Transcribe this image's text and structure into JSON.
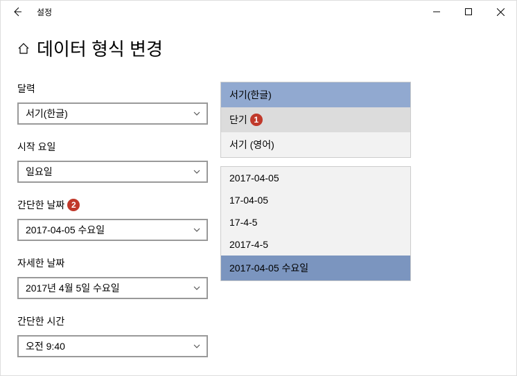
{
  "titlebar": {
    "app_title": "설정"
  },
  "page": {
    "title": "데이터 형식 변경"
  },
  "fields": {
    "calendar": {
      "label": "달력",
      "value": "서기(한글)"
    },
    "first_day": {
      "label": "시작 요일",
      "value": "일요일"
    },
    "short_date": {
      "label": "간단한 날짜",
      "value": "2017-04-05 수요일",
      "badge": "2"
    },
    "long_date": {
      "label": "자세한 날짜",
      "value": "2017년 4월 5일 수요일"
    },
    "short_time": {
      "label": "간단한 시간",
      "value": "오전 9:40"
    }
  },
  "calendar_dropdown": {
    "options": [
      {
        "label": "서기(한글)",
        "state": "selected"
      },
      {
        "label": "단기",
        "state": "hover",
        "badge": "1"
      },
      {
        "label": "서기 (영어)",
        "state": ""
      }
    ]
  },
  "short_date_dropdown": {
    "options": [
      {
        "label": "2017-04-05",
        "state": ""
      },
      {
        "label": "17-04-05",
        "state": ""
      },
      {
        "label": "17-4-5",
        "state": ""
      },
      {
        "label": "2017-4-5",
        "state": ""
      },
      {
        "label": "2017-04-05 수요일",
        "state": "selected2"
      }
    ]
  }
}
